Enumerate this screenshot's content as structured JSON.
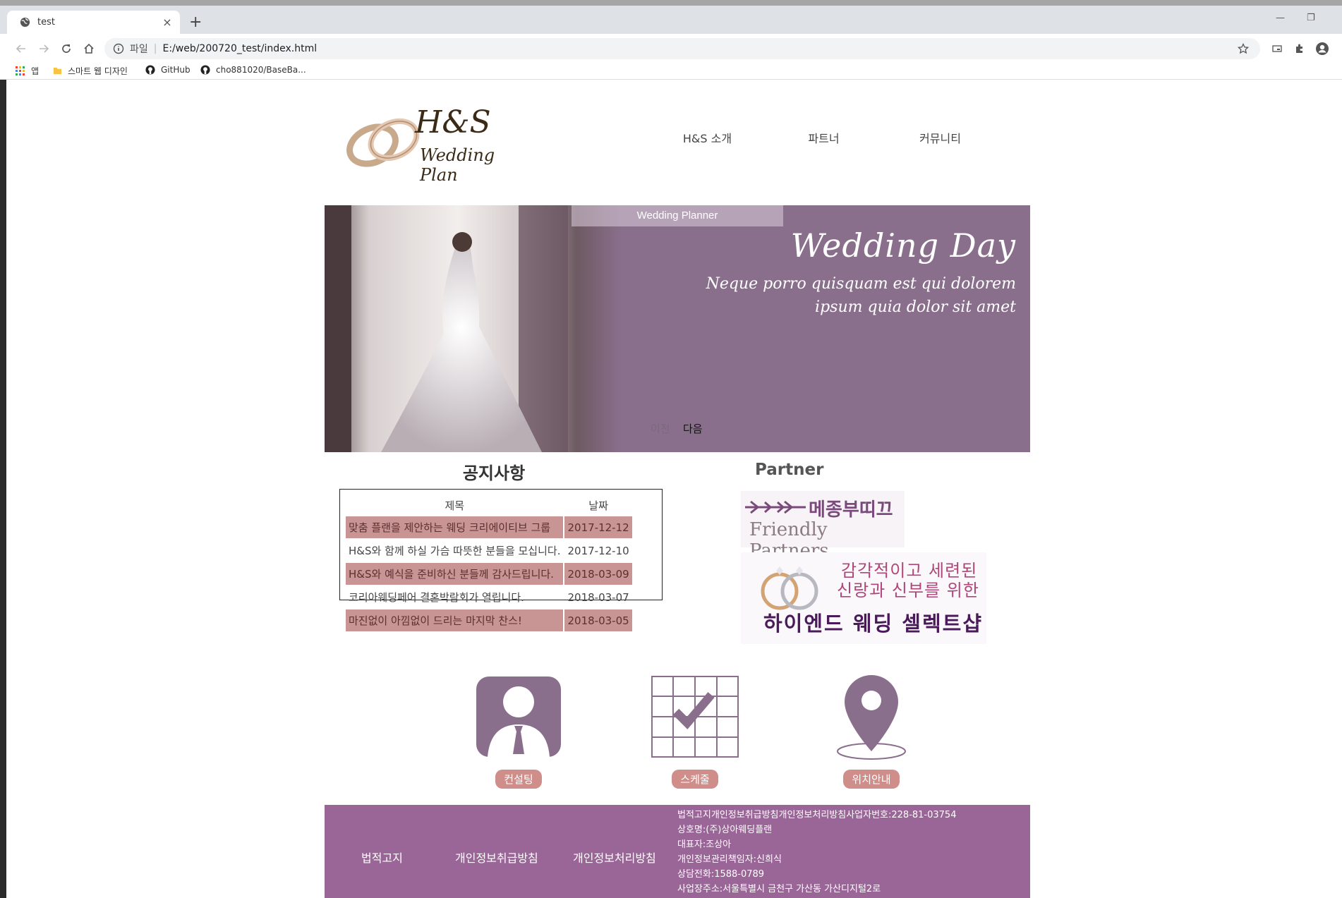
{
  "browser": {
    "tab_title": "test",
    "tab_close": "×",
    "new_tab": "+",
    "url_scheme": "파일",
    "url": "E:/web/200720_test/index.html",
    "window": {
      "minimize": "—",
      "restore": "❐"
    },
    "bookmarks": [
      "앱",
      "스마트 웹 디자인",
      "GitHub",
      "cho881020/BaseBa..."
    ]
  },
  "site": {
    "logo": {
      "brand": "H&S",
      "sub": "Wedding Plan"
    },
    "nav": [
      "H&S 소개",
      "파트너",
      "커뮤니티"
    ],
    "hero": {
      "label": "Wedding Planner",
      "title": "Wedding Day",
      "subtitle_line1": "Neque porro quisquam est qui dolorem",
      "subtitle_line2": "ipsum quia dolor sit amet",
      "prev": "이전",
      "next": "다음"
    },
    "notice": {
      "title": "공지사항",
      "headers": [
        "제목",
        "날짜"
      ],
      "rows": [
        [
          "맞춤 플랜을 제안하는 웨딩 크리에이티브 그룹",
          "2017-12-12"
        ],
        [
          "H&S와 함께 하실 가슴 따뜻한 분들을 모십니다.",
          "2017-12-10"
        ],
        [
          "H&S와 예식을 준비하신 분들께 감사드립니다.",
          "2018-03-09"
        ],
        [
          "코리아웨딩페어 결혼박람회가 열립니다.",
          "2018-03-07"
        ],
        [
          "마진없이 아낌없이 드리는 마지막 찬스!",
          "2018-03-05"
        ]
      ]
    },
    "partner": {
      "title": "Partner",
      "p1_line1": "메종부띠끄",
      "p1_line2": "Friendly Partners",
      "p2_line1": "감각적이고 세련된",
      "p2_line2": "신랑과 신부를 위한",
      "p2_line3": "하이엔드 웨딩 셀렉트샵"
    },
    "quick": [
      "컨설팅",
      "스케줄",
      "위치안내"
    ],
    "footer": {
      "links": [
        "법적고지",
        "개인정보취급방침",
        "개인정보처리방침"
      ],
      "info": [
        "법적고지개인정보취급방침개인정보처리방침사업자번호:228-81-03754",
        "상호명:(주)상아웨딩플랜",
        "대표자:조상아",
        "개인정보관리책임자:신희식",
        "상담전화:1588-0789",
        "사업장주소:서울특별시 금천구 가산동 가산디지털2로"
      ]
    }
  },
  "colors": {
    "hero_bg": "#8a6f8c",
    "notice_row": "#c99494",
    "quick_btn": "#d08e8a",
    "footer_bg": "#9a6697",
    "icon": "#8a6f8c"
  }
}
